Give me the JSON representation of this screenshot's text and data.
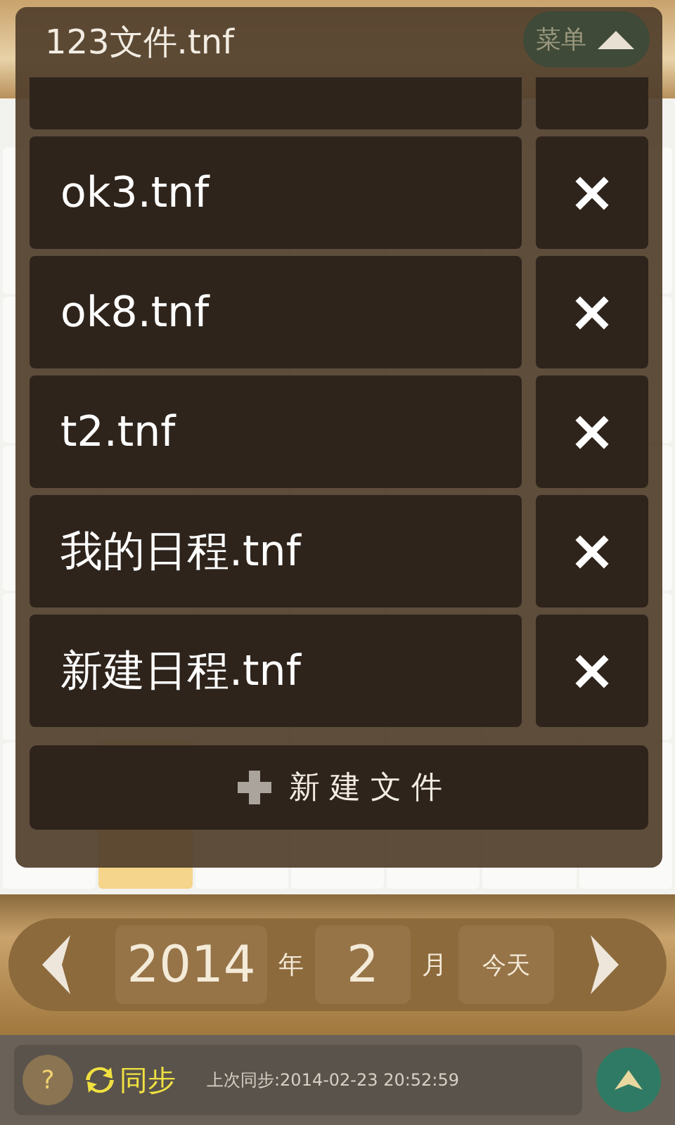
{
  "header": {
    "menu_button": "菜单"
  },
  "calendar": {
    "last_week": [
      {
        "today": false
      },
      {
        "today": true
      },
      {
        "today": false
      },
      {
        "today": false
      },
      {
        "today": false
      },
      {
        "today": false
      },
      {
        "today": false
      }
    ]
  },
  "file_dialog": {
    "title": "123文件.tnf",
    "files": [
      {
        "name": "ok3.tnf",
        "delete": "×"
      },
      {
        "name": "ok8.tnf",
        "delete": "×"
      },
      {
        "name": "t2.tnf",
        "delete": "×"
      },
      {
        "name": "我的日程.tnf",
        "delete": "×"
      },
      {
        "name": "新建日程.tnf",
        "delete": "×"
      }
    ],
    "new_file_button": "新 建 文 件"
  },
  "month_nav": {
    "year": "2014",
    "year_unit": "年",
    "month": "2",
    "month_unit": "月",
    "today_button": "今天"
  },
  "status_bar": {
    "help": "?",
    "sync_label": "同步",
    "last_sync": "上次同步:2014-02-23 20:52:59"
  }
}
